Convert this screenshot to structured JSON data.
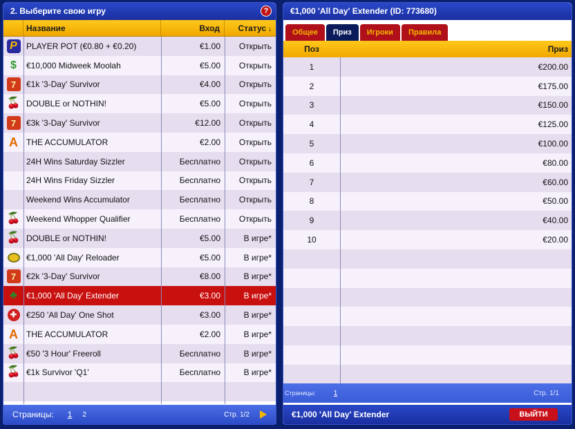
{
  "left": {
    "title": "2. Выберите свою игру",
    "help_icon": "?",
    "columns": {
      "name": "Название",
      "entry": "Вход",
      "status": "Статус",
      "sort_icon": "↓"
    },
    "rows": [
      {
        "icon": "P",
        "name": "PLAYER POT  (€0.80 + €0.20)",
        "entry": "€1.00",
        "status": "Открыть"
      },
      {
        "icon": "$",
        "name": "€10,000 Midweek Moolah",
        "entry": "€5.00",
        "status": "Открыть"
      },
      {
        "icon": "7",
        "name": "€1k '3-Day' Survivor",
        "entry": "€4.00",
        "status": "Открыть"
      },
      {
        "icon": "🍒",
        "name": "DOUBLE or NOTHIN!",
        "entry": "€5.00",
        "status": "Открыть"
      },
      {
        "icon": "7",
        "name": "€3k '3-Day' Survivor",
        "entry": "€12.00",
        "status": "Открыть"
      },
      {
        "icon": "A",
        "name": "THE ACCUMULATOR",
        "entry": "€2.00",
        "status": "Открыть"
      },
      {
        "icon": "",
        "name": "24H Wins Saturday Sizzler",
        "entry": "Бесплатно",
        "status": "Открыть"
      },
      {
        "icon": "",
        "name": "24H Wins Friday Sizzler",
        "entry": "Бесплатно",
        "status": "Открыть"
      },
      {
        "icon": "",
        "name": "Weekend Wins Accumulator",
        "entry": "Бесплатно",
        "status": "Открыть"
      },
      {
        "icon": "🍒",
        "name": "Weekend Whopper Qualifier",
        "entry": "Бесплатно",
        "status": "Открыть"
      },
      {
        "icon": "🍒",
        "name": "DOUBLE or NOTHIN!",
        "entry": "€5.00",
        "status": "В игре*"
      },
      {
        "icon": "",
        "name": "€1,000 'All Day' Reloader",
        "entry": "€5.00",
        "status": "В игре*"
      },
      {
        "icon": "7",
        "name": "€2k '3-Day' Survivor",
        "entry": "€8.00",
        "status": "В игре*"
      },
      {
        "icon": "♣",
        "name": "€1,000 'All Day' Extender",
        "entry": "€3.00",
        "status": "В игре*"
      },
      {
        "icon": "✚",
        "name": "€250 'All Day' One Shot",
        "entry": "€3.00",
        "status": "В игре*"
      },
      {
        "icon": "A",
        "name": "THE ACCUMULATOR",
        "entry": "€2.00",
        "status": "В игре*"
      },
      {
        "icon": "🍒",
        "name": "€50 '3 Hour' Freeroll",
        "entry": "Бесплатно",
        "status": "В игре*"
      },
      {
        "icon": "🍒",
        "name": "€1k Survivor 'Q1'",
        "entry": "Бесплатно",
        "status": "В игре*"
      }
    ],
    "footer": {
      "pages_label": "Страницы:",
      "page1": "1",
      "page2": "2",
      "page_info": "Стр. 1/2"
    }
  },
  "right": {
    "title": "€1,000 'All Day' Extender (ID: 773680)",
    "tabs": [
      "Общее",
      "Приз",
      "Игроки",
      "Правила"
    ],
    "active_tab": 1,
    "columns": {
      "pos": "Поз",
      "prize": "Приз"
    },
    "prizes": [
      {
        "pos": "1",
        "prize": "€200.00"
      },
      {
        "pos": "2",
        "prize": "€175.00"
      },
      {
        "pos": "3",
        "prize": "€150.00"
      },
      {
        "pos": "4",
        "prize": "€125.00"
      },
      {
        "pos": "5",
        "prize": "€100.00"
      },
      {
        "pos": "6",
        "prize": "€80.00"
      },
      {
        "pos": "7",
        "prize": "€60.00"
      },
      {
        "pos": "8",
        "prize": "€50.00"
      },
      {
        "pos": "9",
        "prize": "€40.00"
      },
      {
        "pos": "10",
        "prize": "€20.00"
      }
    ],
    "pages": {
      "pages_label": "Страницы:",
      "page1": "1",
      "page_info": "Стр. 1/1"
    },
    "footer": {
      "name": "€1,000 'All Day' Extender",
      "exit_label": "ВЫЙТИ"
    }
  },
  "colors": {
    "background": "#0a1f6e",
    "header_blue": "#1a2fa0",
    "column_header_gold": "#f0a800",
    "selected_row": "#c8100f",
    "tab_red": "#b0101a",
    "tab_active": "#0a1a5a"
  }
}
